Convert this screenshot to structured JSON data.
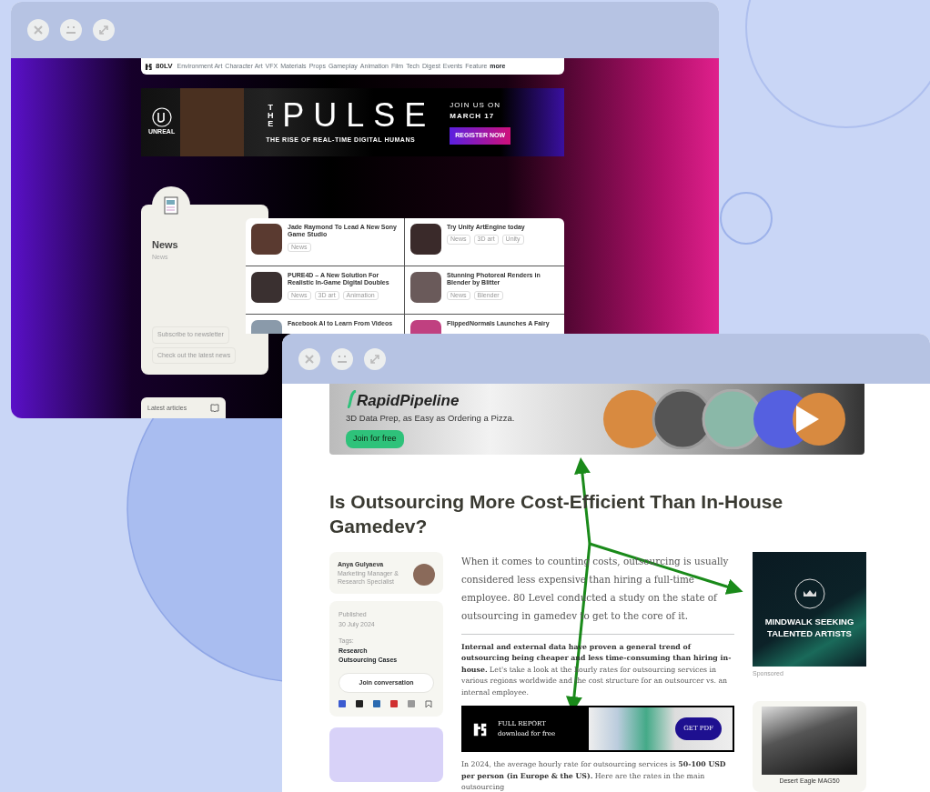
{
  "back_window": {
    "site_nav": {
      "logo": "80LV",
      "items": [
        "Environment Art",
        "Character Art",
        "VFX",
        "Materials",
        "Props",
        "Gameplay",
        "Animation",
        "Film",
        "Tech",
        "Digest",
        "Events",
        "Feature"
      ],
      "more": "more"
    },
    "hero_banner": {
      "brand": "UNREAL",
      "title_prefix": "THE",
      "title": "PULSE",
      "subtitle": "THE RISE OF REAL-TIME DIGITAL HUMANS",
      "date_line_1": "JOIN US ON",
      "date_line_2": "MARCH 17",
      "cta": "REGISTER NOW"
    },
    "news_panel": {
      "title": "News",
      "subtitle": "News",
      "links": [
        "Subscribe to newsletter",
        "Check out the latest news"
      ]
    },
    "news_items": [
      {
        "title": "Jade Raymond To Lead A New Sony Game Studio",
        "tags": [
          "News"
        ]
      },
      {
        "title": "Try Unity ArtEngine today",
        "tags": [
          "News",
          "3D art",
          "Unity"
        ]
      },
      {
        "title": "PURE4D – A New Solution For Realistic In-Game Digital Doubles",
        "tags": [
          "News",
          "3D art",
          "Animation"
        ]
      },
      {
        "title": "Stunning Photoreal Renders in Blender by Blitter",
        "tags": [
          "News",
          "Blender"
        ]
      },
      {
        "title": "Facebook AI to Learn From Videos"
      },
      {
        "title": "FlippedNormals Launches A Fairy"
      }
    ],
    "latest_articles": {
      "title": "Latest articles"
    }
  },
  "front_window": {
    "ad_banner": {
      "brand": "RapidPipeline",
      "tagline": "3D Data Prep, as Easy as Ordering a Pizza.",
      "cta": "Join for free"
    },
    "article": {
      "title": "Is Outsourcing More Cost-Efficient Than In-House Gamedev?",
      "author": {
        "name": "Anya Gulyaeva",
        "role": "Marketing Manager & Research Specialist"
      },
      "published_label": "Published",
      "published_date": "30 July 2024",
      "tags_label": "Tags:",
      "tags": [
        "Research",
        "Outsourcing Cases"
      ],
      "join_button": "Join conversation",
      "lead": "When it comes to counting costs, outsourcing is usually considered less expensive than hiring a full-time employee. 80 Level conducted a study on the state of outsourcing in gamedev to get to the core of it.",
      "paragraphs": [
        "**Internal and external data have proven a general trend of outsourcing being cheaper and less time-consuming than hiring in-house.** Let's take a look at the hourly rates for outsourcing services in various regions worldwide and the cost structure for an outsourcer vs. an internal employee.",
        "In 2024, the average hourly rate for outsourcing services is **50-100 USD per person (in Europe & the US).** Here are the rates in the main outsourcing"
      ],
      "report_banner": {
        "title": "FULL REPORT",
        "subtitle": "download for free",
        "cta": "GET PDF"
      }
    },
    "sidebar_ad": {
      "text": "MINDWALK SEEKING TALENTED ARTISTS",
      "label": "Sponsored"
    },
    "product": {
      "name": "Desert Eagle MAG50"
    }
  }
}
